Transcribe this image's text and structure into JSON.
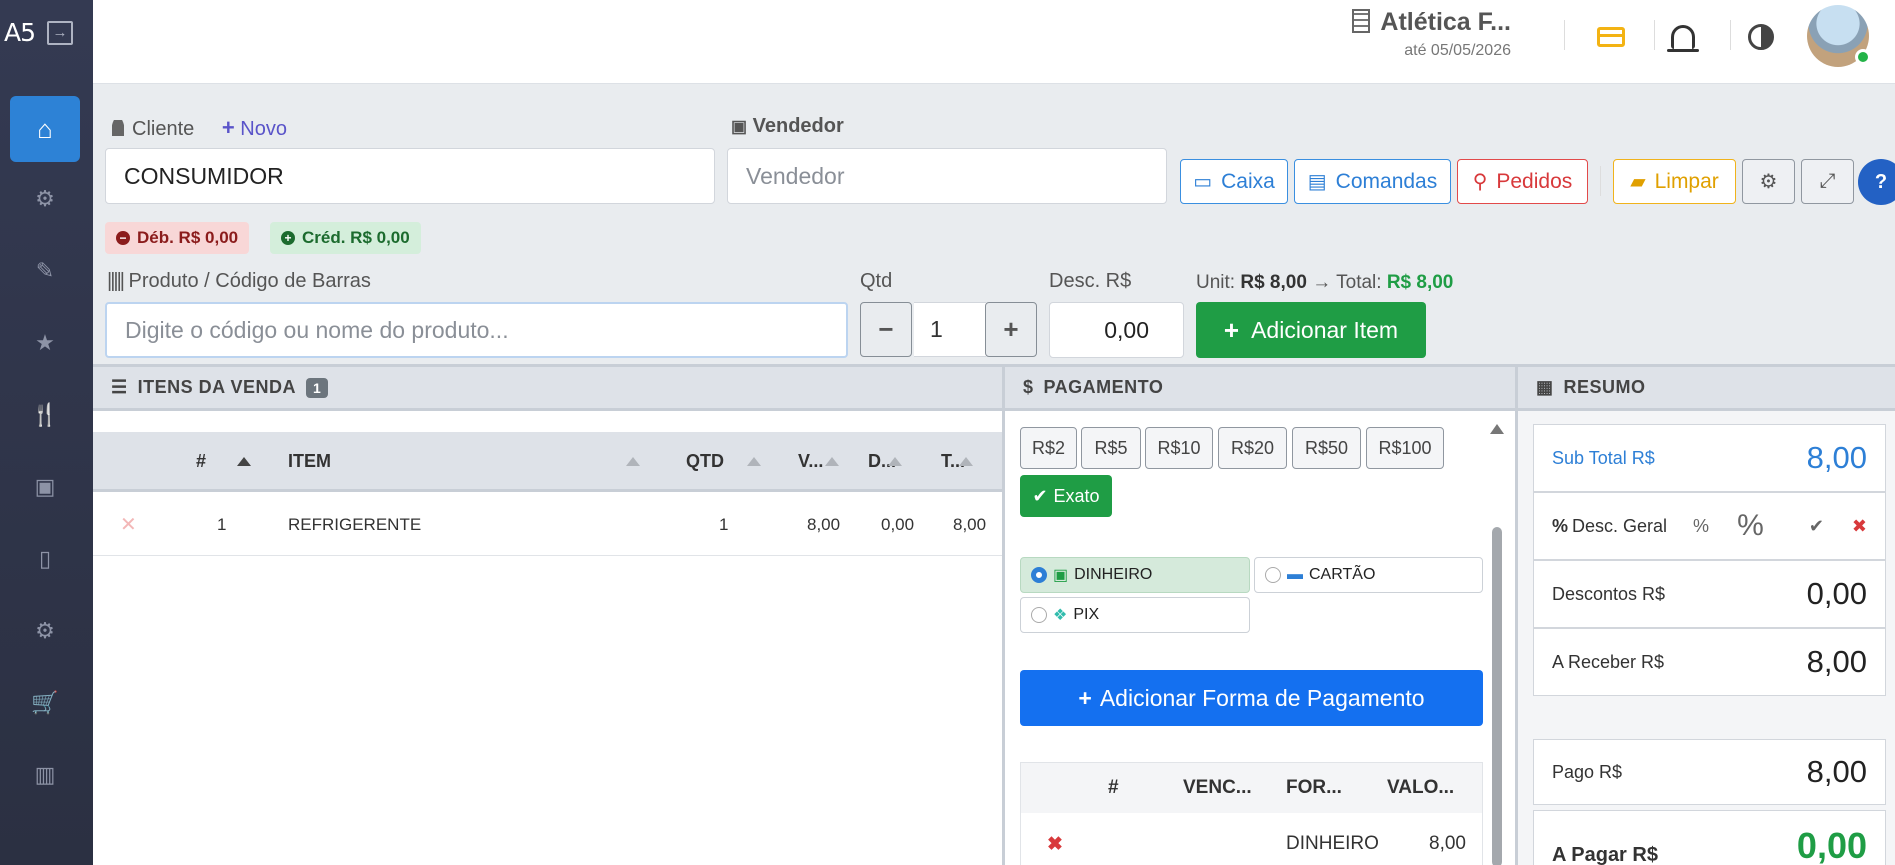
{
  "sidebar": {
    "logo": "A5",
    "items": [
      {
        "name": "home-icon",
        "glyph": "⌂"
      },
      {
        "name": "gear-icon",
        "glyph": "⚙"
      },
      {
        "name": "pencil-icon",
        "glyph": "✎"
      },
      {
        "name": "star-icon",
        "glyph": "★"
      },
      {
        "name": "utensils-icon",
        "glyph": "🍴"
      },
      {
        "name": "money-icon",
        "glyph": "▣"
      },
      {
        "name": "mobile-icon",
        "glyph": "▯"
      },
      {
        "name": "gears-icon",
        "glyph": "⚙"
      },
      {
        "name": "cart-icon",
        "glyph": "🛒"
      },
      {
        "name": "chart-icon",
        "glyph": "▥"
      }
    ]
  },
  "topbar": {
    "company": "Atlética F...",
    "until": "até 05/05/2026"
  },
  "form": {
    "cliente_label": "Cliente",
    "novo_label": "Novo",
    "cliente_value": "CONSUMIDOR",
    "vendedor_label": "Vendedor",
    "vendedor_placeholder": "Vendedor"
  },
  "actions": {
    "caixa": "Caixa",
    "comandas": "Comandas",
    "pedidos": "Pedidos",
    "limpar": "Limpar",
    "help": "?"
  },
  "balances": {
    "debito": "Déb. R$ 0,00",
    "credito": "Créd. R$ 0,00"
  },
  "product": {
    "label": "Produto / Código de Barras",
    "placeholder": "Digite o código ou nome do produto...",
    "qtd_label": "Qtd",
    "qtd_value": "1",
    "desc_label": "Desc. R$",
    "desc_value": "0,00",
    "unit_prefix": "Unit:",
    "unit_value": "R$ 8,00",
    "total_prefix": "→ Total:",
    "total_value": "R$ 8,00",
    "add_button": "Adicionar Item"
  },
  "items_panel": {
    "title": "ITENS DA VENDA",
    "count": "1",
    "columns": [
      "#",
      "ITEM",
      "QTD",
      "V...",
      "D...",
      "T..."
    ],
    "rows": [
      {
        "num": "1",
        "item": "REFRIGERENTE",
        "qtd": "1",
        "valor": "8,00",
        "desc": "0,00",
        "total": "8,00"
      }
    ]
  },
  "payment_panel": {
    "title": "PAGAMENTO",
    "quick_values": [
      "R$2",
      "R$5",
      "R$10",
      "R$20",
      "R$50",
      "R$100"
    ],
    "exato": "Exato",
    "methods": [
      {
        "label": "DINHEIRO",
        "selected": true
      },
      {
        "label": "CARTÃO",
        "selected": false
      },
      {
        "label": "PIX",
        "selected": false
      }
    ],
    "add_payment": "Adicionar Forma de Pagamento",
    "table_columns": [
      "#",
      "VENC...",
      "FOR...",
      "VALO..."
    ],
    "table_rows": [
      {
        "forma": "DINHEIRO",
        "valor": "8,00"
      }
    ]
  },
  "summary_panel": {
    "title": "RESUMO",
    "subtotal_label": "Sub Total R$",
    "subtotal_value": "8,00",
    "desc_geral_label": "Desc. Geral",
    "desc_geral_pct": "%",
    "desc_geral_big_pct": "%",
    "descontos_label": "Descontos R$",
    "descontos_value": "0,00",
    "a_receber_label": "A Receber R$",
    "a_receber_value": "8,00",
    "pago_label": "Pago R$",
    "pago_value": "8,00",
    "a_pagar_label": "A Pagar R$",
    "a_pagar_value": "0,00"
  },
  "colors": {
    "primary": "#2d82d6",
    "success": "#1f9d45",
    "danger": "#d8393b",
    "warning": "#f0b31c",
    "sidebar": "#343a52"
  }
}
